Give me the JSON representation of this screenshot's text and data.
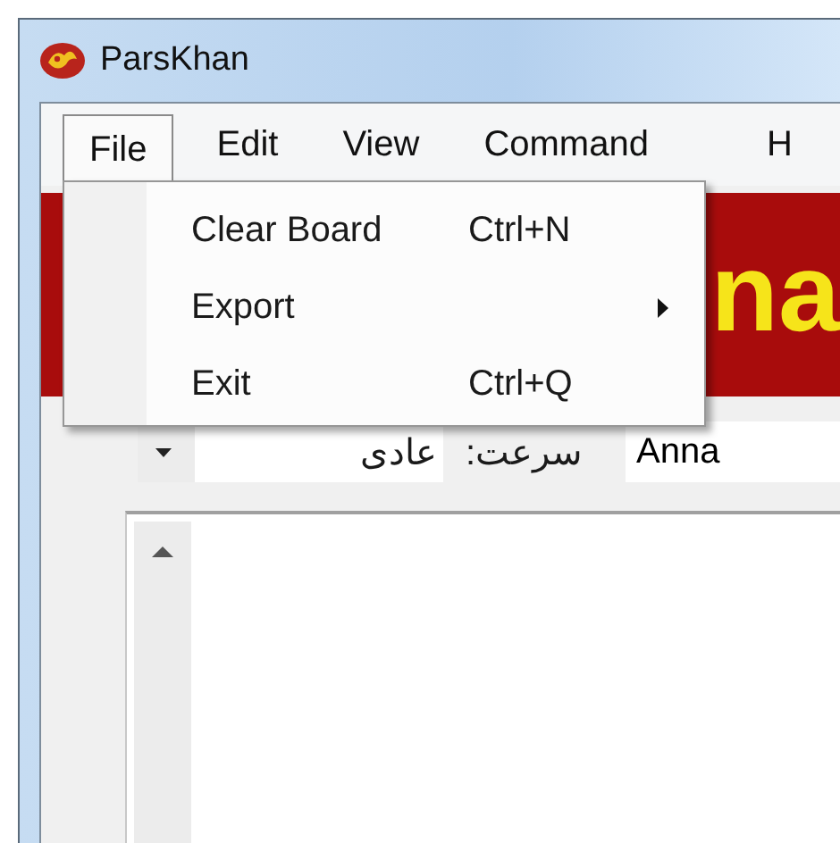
{
  "window": {
    "title": "ParsKhan"
  },
  "menu_bar": [
    {
      "label": "File",
      "selected": true
    },
    {
      "label": "Edit",
      "selected": false
    },
    {
      "label": "View",
      "selected": false
    },
    {
      "label": "Command",
      "selected": false
    },
    {
      "label": "H",
      "selected": false
    }
  ],
  "open_menu": {
    "items": [
      {
        "kind": "command",
        "label": "Clear Board",
        "shortcut": "Ctrl+N"
      },
      {
        "kind": "submenu",
        "label": "Export"
      },
      {
        "kind": "command",
        "label": "Exit",
        "shortcut": "Ctrl+Q"
      }
    ]
  },
  "banner": {
    "text": "na"
  },
  "speed": {
    "label": "سرعت:",
    "value": "عادی"
  },
  "player": {
    "value": "Anna"
  }
}
